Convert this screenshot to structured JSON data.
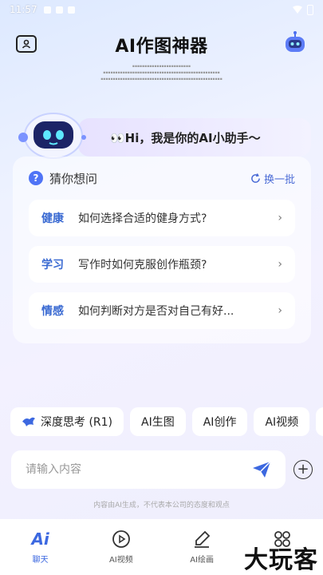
{
  "status_bar": {
    "time": "11:57"
  },
  "header": {
    "title": "AI作图神器"
  },
  "greeting": {
    "text": "👀Hi，我是你的AI小助手～"
  },
  "card": {
    "heading": "猜你想问",
    "refresh_label": "换一批",
    "items": [
      {
        "tag": "健康",
        "question": "如何选择合适的健身方式?"
      },
      {
        "tag": "学习",
        "question": "写作时如何克服创作瓶颈?"
      },
      {
        "tag": "情感",
        "question": "如何判断对方是否对自己有好..."
      }
    ]
  },
  "chips": [
    {
      "label": "深度思考 (R1)"
    },
    {
      "label": "AI生图"
    },
    {
      "label": "AI创作"
    },
    {
      "label": "AI视频"
    }
  ],
  "input": {
    "placeholder": "请输入内容"
  },
  "ai_note": "内容由AI生成，不代表本公司的态度和观点",
  "tabs": [
    {
      "label": "聊天",
      "icon": "ai-chat-icon",
      "active": true
    },
    {
      "label": "AI视频",
      "icon": "play-circle-icon"
    },
    {
      "label": "AI绘画",
      "icon": "brush-icon"
    },
    {
      "label": "",
      "icon": "grid-icon"
    }
  ],
  "watermark": "大玩客",
  "colors": {
    "accent": "#3c68e0",
    "tag": "#3a6ad2",
    "bubble": "#e7e2ff"
  }
}
